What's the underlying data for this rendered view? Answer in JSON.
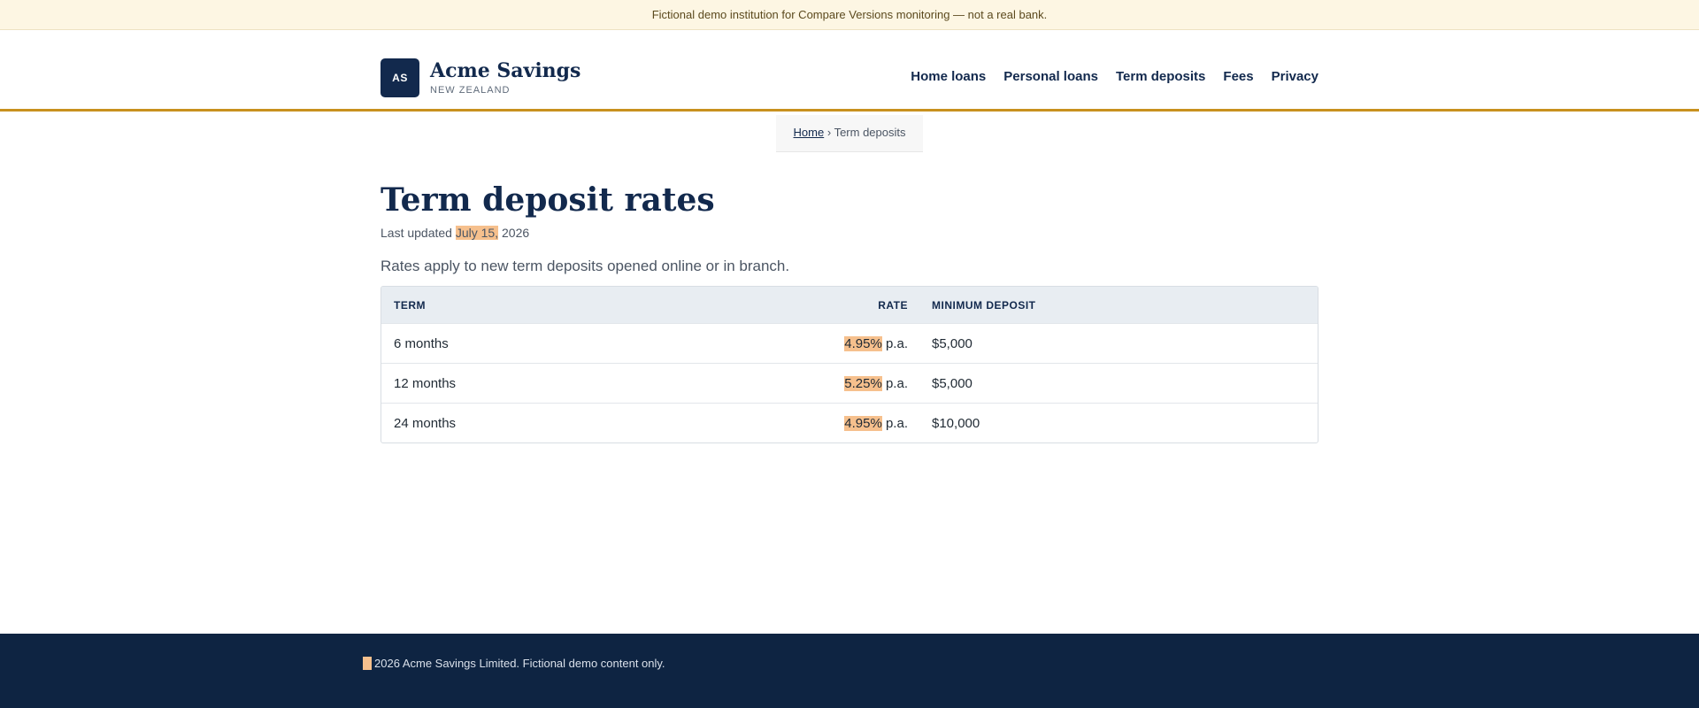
{
  "notice": {
    "text": "Fictional demo institution for Compare Versions monitoring — not a real bank."
  },
  "header": {
    "logo_initials": "AS",
    "brand_name": "Acme Savings",
    "brand_sub": "NEW ZEALAND",
    "accent_color": "#c8911e",
    "nav": [
      "Home loans",
      "Personal loans",
      "Term deposits",
      "Fees",
      "Privacy"
    ]
  },
  "breadcrumb": {
    "home": "Home",
    "separator": "›",
    "current": "Term deposits"
  },
  "main": {
    "title": "Term deposit rates",
    "updated_prefix": "Last updated",
    "updated_highlight": "July 15,",
    "updated_suffix": "2026",
    "intro": "Rates apply to new term deposits opened online or in branch.",
    "highlight_color": "#f6c08d"
  },
  "table": {
    "headers": {
      "term": "TERM",
      "rate": "RATE",
      "min": "MINIMUM DEPOSIT"
    },
    "rows": [
      {
        "term": "6 months",
        "rate": "4.95%",
        "unit": "p.a.",
        "min": "$5,000"
      },
      {
        "term": "12 months",
        "rate": "5.25%",
        "unit": "p.a.",
        "min": "$5,000"
      },
      {
        "term": "24 months",
        "rate": "4.95%",
        "unit": "p.a.",
        "min": "$10,000"
      }
    ]
  },
  "footer": {
    "text": "2026 Acme Savings Limited. Fictional demo content only."
  }
}
